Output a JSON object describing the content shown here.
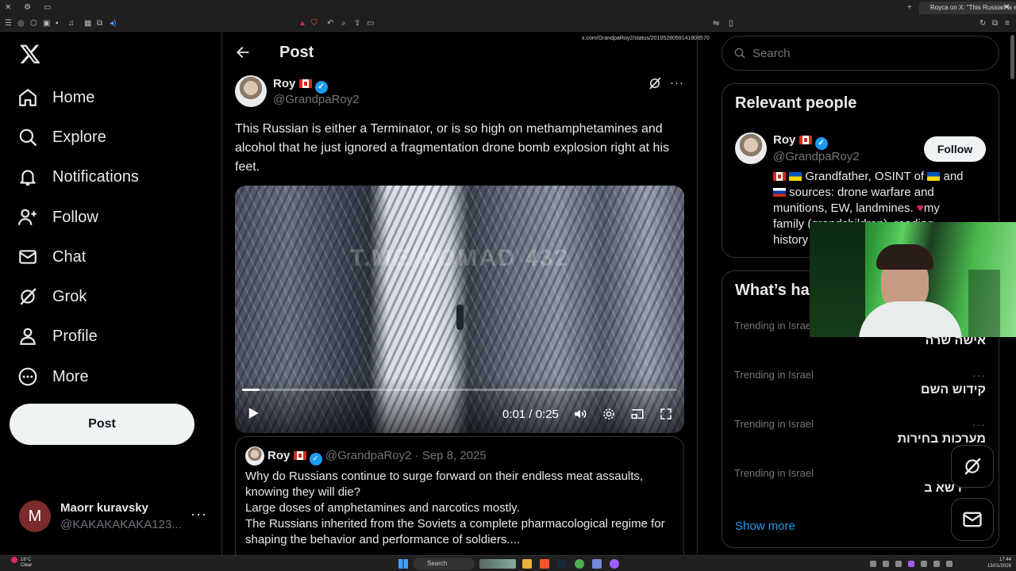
{
  "browser": {
    "tab_title": "Royca on X: \"This Russian is eith",
    "url": "x.com/GrandpaRoy2/status/2010528059141808570"
  },
  "nav": {
    "items": [
      {
        "label": "Home",
        "icon": "home-icon"
      },
      {
        "label": "Explore",
        "icon": "search-icon"
      },
      {
        "label": "Notifications",
        "icon": "bell-icon"
      },
      {
        "label": "Follow",
        "icon": "add-person-icon"
      },
      {
        "label": "Chat",
        "icon": "mail-icon"
      },
      {
        "label": "Grok",
        "icon": "grok-icon"
      },
      {
        "label": "Profile",
        "icon": "person-icon"
      },
      {
        "label": "More",
        "icon": "more-circle-icon"
      }
    ],
    "post_label": "Post",
    "account": {
      "initial": "M",
      "name": "Maorr kuravsky",
      "handle": "@KAKAKAKAKA123..."
    }
  },
  "header": {
    "title": "Post"
  },
  "tweet": {
    "name": "Roy",
    "handle": "@GrandpaRoy2",
    "text": "This Russian is either a Terminator, or is so high on methamphetamines and alcohol that he just ignored a fragmentation drone bomb explosion right at his feet.",
    "watermark": "T.ME/NOMAD 432",
    "video_time": "0:01 / 0:25",
    "progress": 0.04
  },
  "quote": {
    "name": "Roy",
    "handle": "@GrandpaRoy2",
    "date": "· Sep 8, 2025",
    "lines": [
      "Why do Russians continue to surge forward on their endless meat assaults, knowing they will die?",
      "Large doses of amphetamines and narcotics mostly.",
      "The Russians inherited from the Soviets a complete pharmacological regime for shaping the behavior and performance of soldiers...."
    ]
  },
  "sidebar": {
    "search_placeholder": "Search",
    "relevant": {
      "title": "Relevant people",
      "name": "Roy",
      "handle": "@GrandpaRoy2",
      "follow_label": "Follow",
      "bio_1": "Grandfather, OSINT of",
      "bio_1b": "and",
      "bio_2": "sources: drone warfare and",
      "bio_3": "munitions, EW, landmines.",
      "bio_3b": "my",
      "bio_4": "family (grandchildren), reading,",
      "bio_5": "history"
    },
    "trends": {
      "title": "What’s happening",
      "items": [
        {
          "category": "Trending in Israel",
          "name": "אישה שרה"
        },
        {
          "category": "Trending in Israel",
          "name": "קידוש השם"
        },
        {
          "category": "Trending in Israel",
          "name": "מערכות בחירות"
        },
        {
          "category": "Trending in Israel",
          "name": "דשא ב"
        }
      ],
      "show_more": "Show more"
    }
  },
  "taskbar": {
    "weather": "16°C",
    "weather_sub": "Clear",
    "search": "Search",
    "time": "17:44",
    "date": "13/01/2026"
  }
}
